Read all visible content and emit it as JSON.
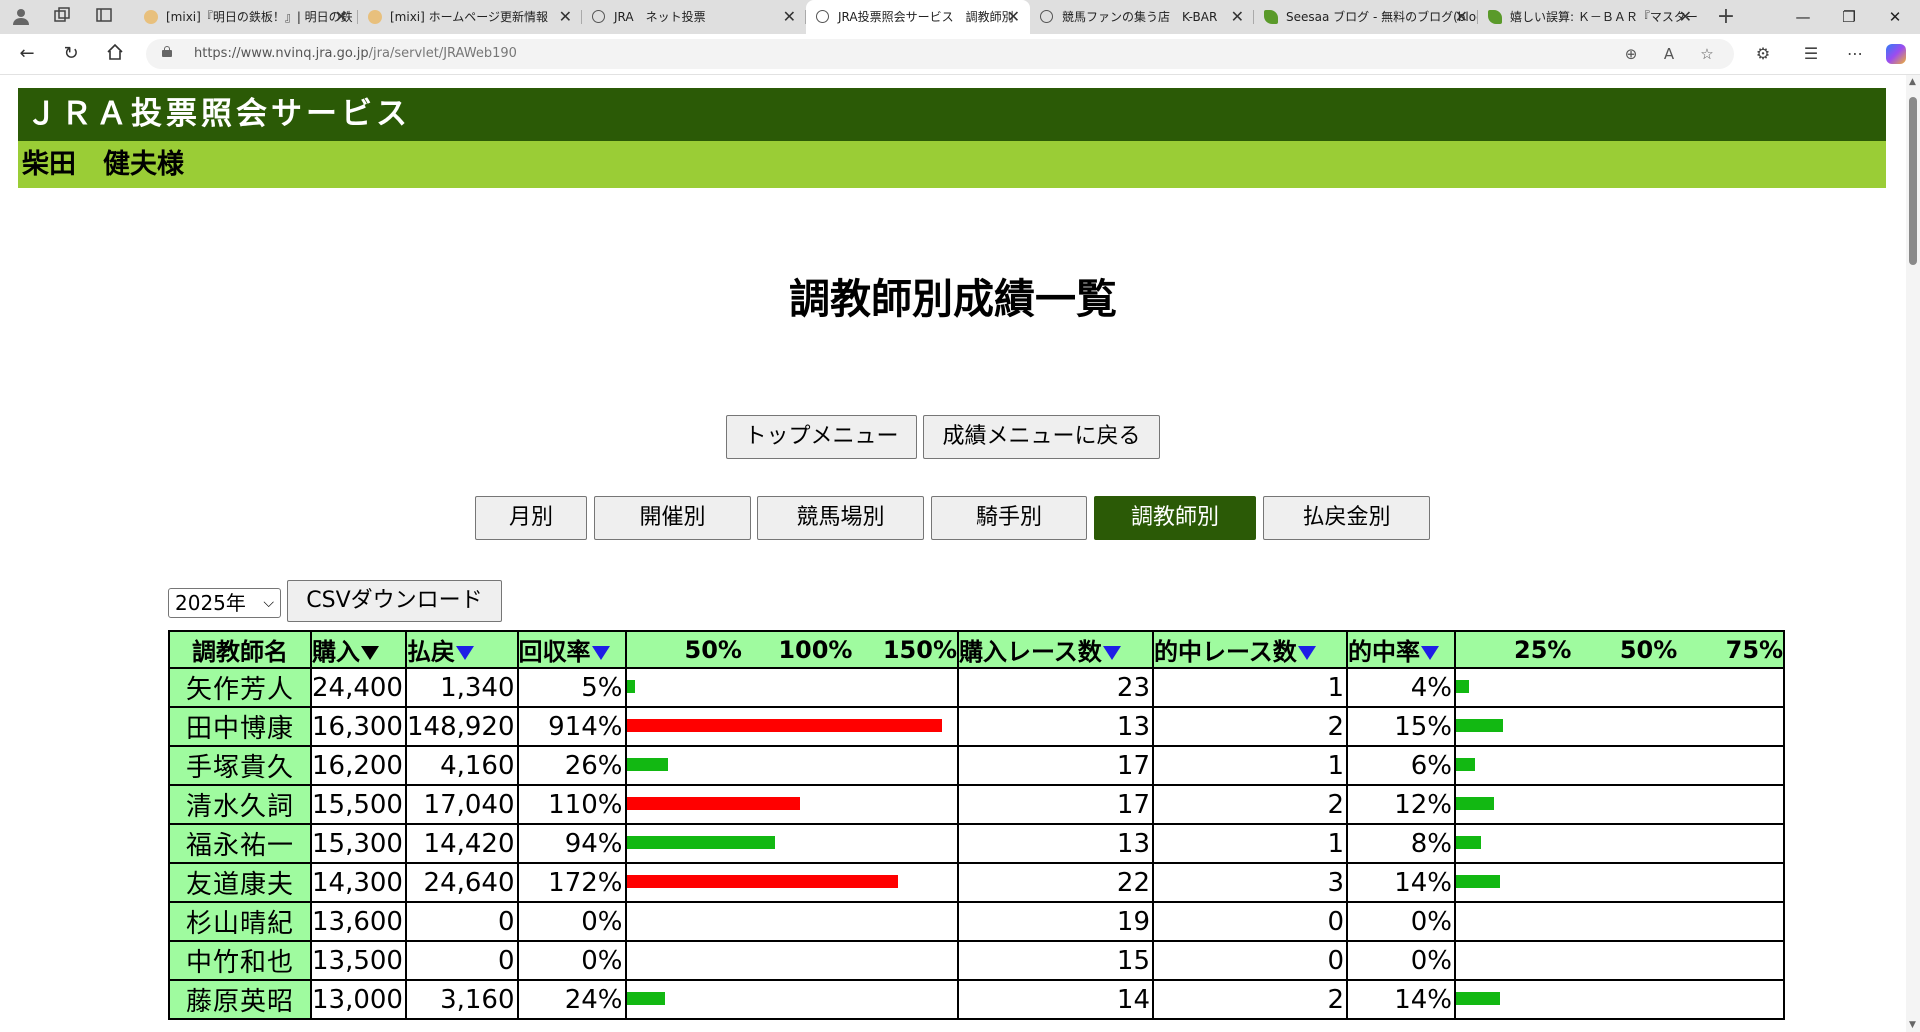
{
  "browser": {
    "tabs": [
      {
        "title": "[mixi]『明日の鉄板！』| 明日の鉄",
        "favicon": "mixi",
        "active": false
      },
      {
        "title": "[mixi] ホームページ更新情報",
        "favicon": "mixi",
        "active": false
      },
      {
        "title": "JRA　ネット投票",
        "favicon": "globe",
        "active": false
      },
      {
        "title": "JRA投票照会サービス　調教師別",
        "favicon": "globe",
        "active": true
      },
      {
        "title": "競馬ファンの集う店　K-BAR",
        "favicon": "globe",
        "active": false
      },
      {
        "title": "Seesaa ブログ - 無料のブログ(blog",
        "favicon": "leaf",
        "active": false
      },
      {
        "title": "嬉しい誤算: Ｋ－ＢＡＲ『マスター",
        "favicon": "leaf",
        "active": false
      }
    ],
    "url_host": "https://www.nvinq.jra.go.jp",
    "url_path": "/jra/servlet/JRAWeb190"
  },
  "header": {
    "service_title": "ＪＲＡ投票照会サービス",
    "user_name": "柴田　健夫様"
  },
  "page_title": "調教師別成績一覧",
  "nav_buttons": {
    "top_menu": "トップメニュー",
    "back_to_results": "成績メニューに戻る"
  },
  "category_tabs": [
    {
      "label": "月別",
      "active": false
    },
    {
      "label": "開催別",
      "active": false
    },
    {
      "label": "競馬場別",
      "active": false
    },
    {
      "label": "騎手別",
      "active": false
    },
    {
      "label": "調教師別",
      "active": true
    },
    {
      "label": "払戻金別",
      "active": false
    }
  ],
  "controls": {
    "year_selected": "2025年",
    "csv_download": "CSVダウンロード"
  },
  "table": {
    "headers": {
      "trainer": "調教師名",
      "purchase": "購入",
      "payout": "払戻",
      "recovery_rate": "回収率",
      "recovery_scale": [
        "50%",
        "100%",
        "150%"
      ],
      "races_bought": "購入レース数",
      "races_hit": "的中レース数",
      "hit_rate": "的中率",
      "hit_scale": [
        "25%",
        "50%",
        "75%"
      ]
    },
    "colors": {
      "header_bg": "#9ffb9f",
      "bar_over_100": "#ff0000",
      "bar_under_100": "#12b812"
    },
    "rows": [
      {
        "trainer": "矢作芳人",
        "purchase": "24,400",
        "payout": "1,340",
        "recovery_rate": "5%",
        "recovery_pct": 5,
        "races_bought": "23",
        "races_hit": "1",
        "hit_rate": "4%",
        "hit_pct": 4
      },
      {
        "trainer": "田中博康",
        "purchase": "16,300",
        "payout": "148,920",
        "recovery_rate": "914%",
        "recovery_pct": 914,
        "races_bought": "13",
        "races_hit": "2",
        "hit_rate": "15%",
        "hit_pct": 15
      },
      {
        "trainer": "手塚貴久",
        "purchase": "16,200",
        "payout": "4,160",
        "recovery_rate": "26%",
        "recovery_pct": 26,
        "races_bought": "17",
        "races_hit": "1",
        "hit_rate": "6%",
        "hit_pct": 6
      },
      {
        "trainer": "清水久詞",
        "purchase": "15,500",
        "payout": "17,040",
        "recovery_rate": "110%",
        "recovery_pct": 110,
        "races_bought": "17",
        "races_hit": "2",
        "hit_rate": "12%",
        "hit_pct": 12
      },
      {
        "trainer": "福永祐一",
        "purchase": "15,300",
        "payout": "14,420",
        "recovery_rate": "94%",
        "recovery_pct": 94,
        "races_bought": "13",
        "races_hit": "1",
        "hit_rate": "8%",
        "hit_pct": 8
      },
      {
        "trainer": "友道康夫",
        "purchase": "14,300",
        "payout": "24,640",
        "recovery_rate": "172%",
        "recovery_pct": 172,
        "races_bought": "22",
        "races_hit": "3",
        "hit_rate": "14%",
        "hit_pct": 14
      },
      {
        "trainer": "杉山晴紀",
        "purchase": "13,600",
        "payout": "0",
        "recovery_rate": "0%",
        "recovery_pct": 0,
        "races_bought": "19",
        "races_hit": "0",
        "hit_rate": "0%",
        "hit_pct": 0
      },
      {
        "trainer": "中竹和也",
        "purchase": "13,500",
        "payout": "0",
        "recovery_rate": "0%",
        "recovery_pct": 0,
        "races_bought": "15",
        "races_hit": "0",
        "hit_rate": "0%",
        "hit_pct": 0
      },
      {
        "trainer": "藤原英昭",
        "purchase": "13,000",
        "payout": "3,160",
        "recovery_rate": "24%",
        "recovery_pct": 24,
        "races_bought": "14",
        "races_hit": "2",
        "hit_rate": "14%",
        "hit_pct": 14
      }
    ]
  }
}
